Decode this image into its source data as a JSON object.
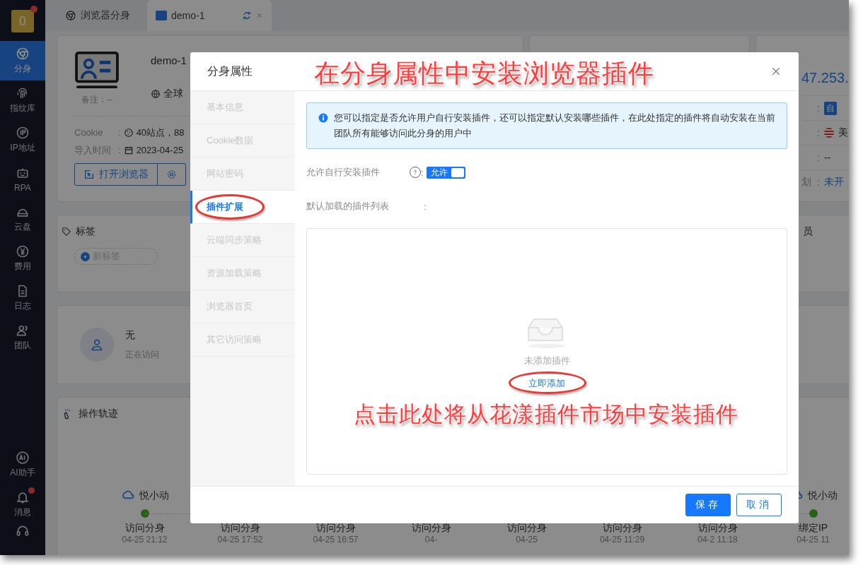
{
  "sidebar": {
    "logo": {
      "text": "0",
      "alert": true
    },
    "items": [
      {
        "label": "分身",
        "selected": true
      },
      {
        "label": "指纹库",
        "selected": false
      },
      {
        "label": "IP地址",
        "selected": false
      },
      {
        "label": "RPA",
        "selected": false
      },
      {
        "label": "云盘",
        "selected": false
      },
      {
        "label": "费用",
        "selected": false
      },
      {
        "label": "日志",
        "selected": false
      },
      {
        "label": "团队",
        "selected": false
      }
    ],
    "bottom_items": [
      {
        "label": "AI助手",
        "unread": false
      },
      {
        "label": "消息",
        "unread": true
      }
    ]
  },
  "tabs": [
    {
      "label": "浏览器分身",
      "selected": false,
      "closable": false
    },
    {
      "label": "demo-1",
      "selected": true,
      "closable": true
    }
  ],
  "profile_card": {
    "separator": ":",
    "name": "demo-1",
    "region": "全球",
    "note_label": "备注：",
    "note": "--",
    "rows": [
      {
        "label": "Cookie",
        "value": "40站点，88"
      },
      {
        "label": "导入时间",
        "value": "2023-04-25"
      }
    ],
    "buttons": [
      "打开浏览器"
    ]
  },
  "ip_card": {
    "separator": ":",
    "address": "47.253.",
    "rows": [
      {
        "value": "自"
      },
      {
        "value": "美"
      },
      {
        "value": "--"
      },
      {
        "label": "划",
        "value": "未开"
      }
    ]
  },
  "tags_card": {
    "title": "标签",
    "add_label": "新标签"
  },
  "members_card": {
    "title": "员"
  },
  "visitor_card": {
    "name": "无",
    "status": "正在访问"
  },
  "timeline": {
    "title": "操作轨迹",
    "events": [
      {
        "action": "访问分身",
        "time": "04-25 21:12",
        "app": "悦小动"
      },
      {
        "action": "访问分身",
        "time": "04-25 17:52"
      },
      {
        "action": "访问分身",
        "time": "04-25 16:57"
      },
      {
        "action": "访问分身",
        "time": "04-"
      },
      {
        "action": "访问分身",
        "time": "04-25"
      },
      {
        "action": "访问分身",
        "time": "04-25 11:29"
      },
      {
        "action": "访问分身",
        "time": "04-2 11:18"
      },
      {
        "action": "绑定IP",
        "time": "04-25 11",
        "app": "悦小动"
      }
    ]
  },
  "modal": {
    "title": "分身属性",
    "separator": ":",
    "nav": [
      {
        "label": "基本信息",
        "selected": false,
        "highlighted": false
      },
      {
        "label": "Cookie数据",
        "selected": false,
        "highlighted": false
      },
      {
        "label": "网站密码",
        "selected": false,
        "highlighted": false
      },
      {
        "label": "插件扩展",
        "selected": true,
        "highlighted": true
      },
      {
        "label": "云端同步策略",
        "selected": false,
        "highlighted": false
      },
      {
        "label": "资源加载策略",
        "selected": false,
        "highlighted": false
      },
      {
        "label": "浏览器首页",
        "selected": false,
        "highlighted": false
      },
      {
        "label": "其它访问策略",
        "selected": false,
        "highlighted": false
      }
    ],
    "notice": "您可以指定是否允许用户自行安装插件，还可以指定默认安装哪些插件，在此处指定的插件将自动安装在当前团队所有能够访问此分身的用户中",
    "fields": [
      {
        "label": "允许自行安装插件",
        "kind": "switch",
        "help": true,
        "on": true,
        "switch_text": "允许"
      },
      {
        "label": "默认加载的插件列表",
        "kind": "list"
      }
    ],
    "empty_text": "未添加插件",
    "add_link": "立即添加",
    "add_link_highlighted": true,
    "buttons": [
      {
        "label": "保存",
        "primary": true
      },
      {
        "label": "取消",
        "primary": false
      }
    ]
  },
  "annotations": [
    {
      "text": "在分身属性中安装浏览器插件",
      "kind": "caption"
    },
    {
      "text": "点击此处将从花漾插件市场中安装插件",
      "kind": "caption"
    }
  ]
}
